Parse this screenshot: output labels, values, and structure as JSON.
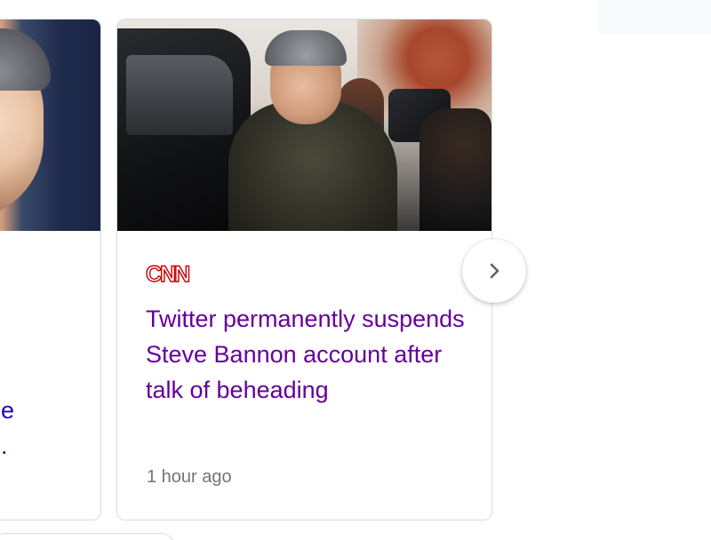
{
  "left_card": {
    "title_fragment_line1": "e",
    "title_fragment_line2": "."
  },
  "main_card": {
    "source": "CNN",
    "headline": "Twitter permanently suspends Steve Bannon account after talk of beheading",
    "timestamp": "1 hour ago"
  },
  "navigation": {
    "next_icon": "chevron-right-icon"
  },
  "colors": {
    "visited_link": "#660099",
    "link": "#1a0dab",
    "timestamp": "#70757a",
    "cnn_red": "#cc0000",
    "card_border": "#dadce0"
  }
}
